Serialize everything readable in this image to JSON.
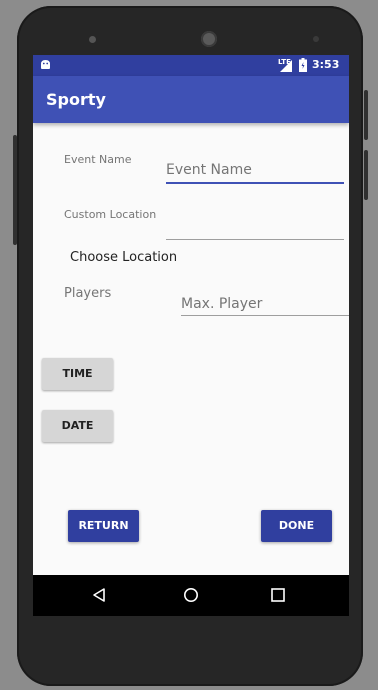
{
  "status_bar": {
    "lte_label": "LTE",
    "time": "3:53",
    "icons": [
      "android-icon",
      "signal-icon",
      "battery-icon"
    ]
  },
  "app_bar": {
    "title": "Sporty"
  },
  "form": {
    "event_name_label": "Event Name",
    "event_name_placeholder": "Event Name",
    "custom_location_label": "Custom Location",
    "custom_location_value": "",
    "choose_location": "Choose Location",
    "players_label": "Players",
    "max_player_placeholder": "Max. Player"
  },
  "buttons": {
    "time": "TIME",
    "date": "DATE",
    "return": "RETURN",
    "done": "DONE"
  },
  "nav_bar": {
    "icons": [
      "back-icon",
      "home-icon",
      "recent-apps-icon"
    ]
  },
  "colors": {
    "status_bar": "#303f9f",
    "app_bar": "#3f51b5",
    "accent": "#3f51b5",
    "button_gray": "#d6d6d6",
    "button_blue": "#303f9f"
  }
}
